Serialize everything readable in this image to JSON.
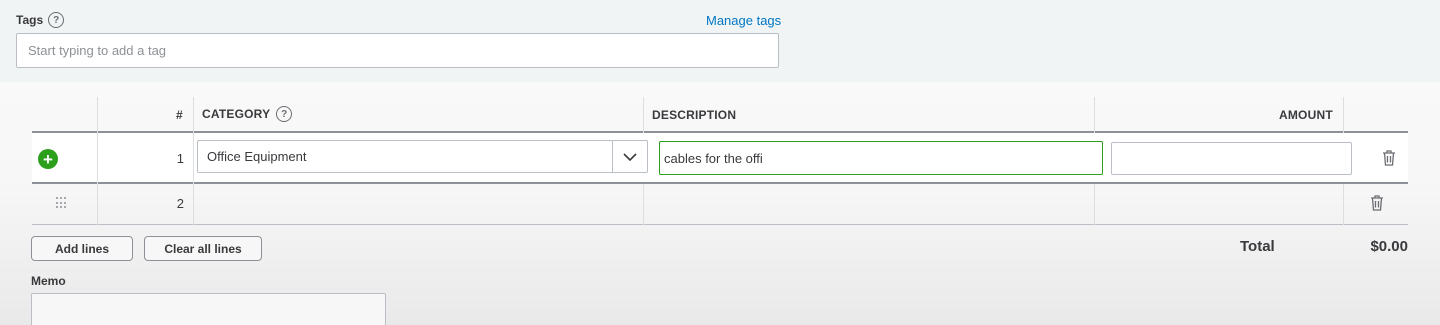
{
  "tags": {
    "label": "Tags",
    "help_glyph": "?",
    "manage_link": "Manage tags",
    "placeholder": "Start typing to add a tag",
    "value": ""
  },
  "table": {
    "headers": {
      "number": "#",
      "category": "CATEGORY",
      "description": "DESCRIPTION",
      "amount": "AMOUNT"
    },
    "rows": [
      {
        "number": "1",
        "category": "Office Equipment",
        "description": "cables for the offi",
        "amount": ""
      },
      {
        "number": "2",
        "category": "",
        "description": "",
        "amount": ""
      }
    ]
  },
  "actions": {
    "add_lines": "Add lines",
    "clear_all_lines": "Clear all lines"
  },
  "totals": {
    "label": "Total",
    "value": "$0.00"
  },
  "memo": {
    "label": "Memo",
    "value": ""
  },
  "colors": {
    "accent_green": "#2ca01c",
    "link_blue": "#0077c5",
    "text": "#393a3d",
    "tags_background": "#f1f4f5"
  },
  "icons": {
    "help": "help-circle-icon",
    "add_row": "plus-circle-icon",
    "drag": "drag-handle-icon",
    "dropdown": "chevron-down-icon",
    "delete": "trash-icon"
  }
}
